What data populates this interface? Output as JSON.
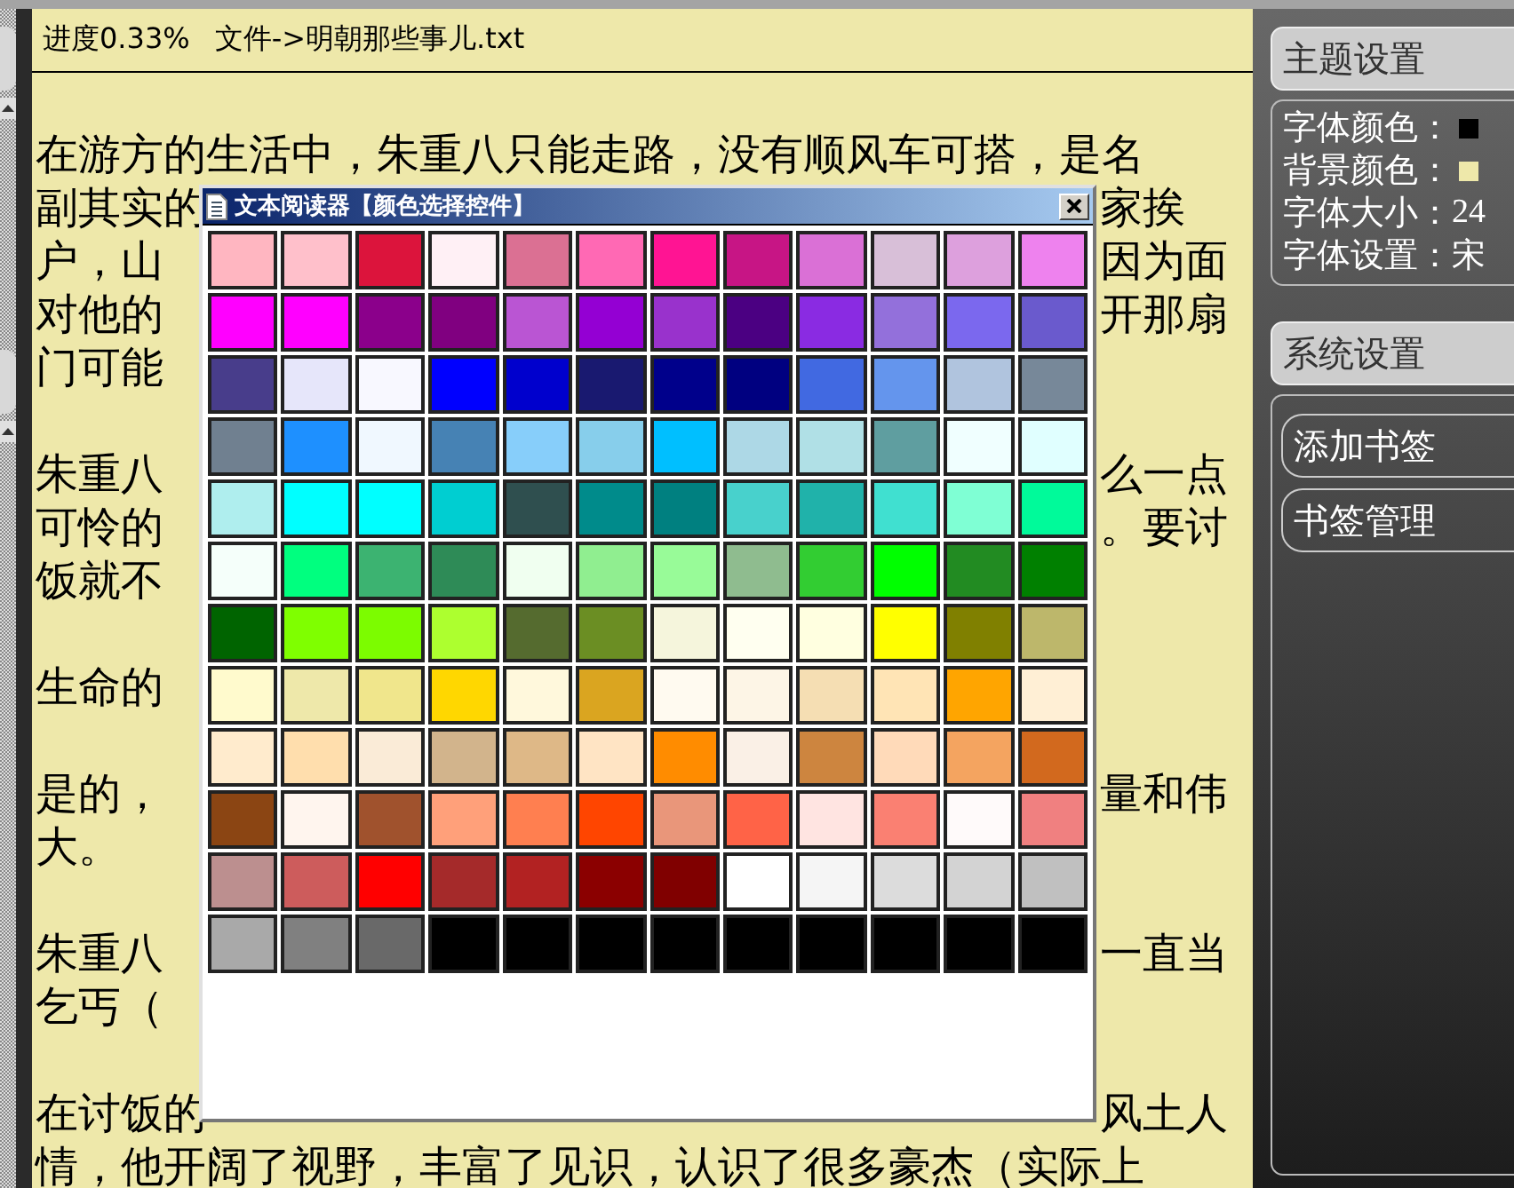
{
  "reader": {
    "progress": "进度0.33%",
    "file": "文件->明朝那些事儿.txt",
    "paragraphs": [
      {
        "lines": [
          {
            "left": "在游方的生活中，朱重八只能走路，没有顺风车可搭，是名"
          },
          {
            "left": "副其实的",
            "right": "家挨"
          },
          {
            "left": "户，山",
            "right": "因为面"
          },
          {
            "left": "对他的",
            "right": "开那扇"
          },
          {
            "left": "门可能"
          }
        ]
      },
      {
        "lines": [
          {
            "left": "朱重八",
            "right": "么一点"
          },
          {
            "left": "可怜的",
            "right": "。要讨"
          },
          {
            "left": "饭就不"
          }
        ]
      },
      {
        "lines": [
          {
            "left": "生命的"
          }
        ]
      },
      {
        "lines": [
          {
            "left": "是的，",
            "right": "量和伟"
          },
          {
            "left": "大。"
          }
        ]
      },
      {
        "lines": [
          {
            "left": "朱重八",
            "right": "一直当"
          },
          {
            "left": "乞丐（"
          }
        ]
      },
      {
        "lines": [
          {
            "left": "在讨饭的",
            "right": "风土人"
          },
          {
            "left": "情，他开阔了视野，丰富了见识，认识了很多豪杰（实际上"
          }
        ]
      }
    ]
  },
  "dialog": {
    "title": "文本阅读器【颜色选择控件】",
    "swatch_rows": [
      [
        {
          "color": "#ffb6c1"
        },
        {
          "color": "#ffc0cb"
        },
        {
          "color": "#dc143c"
        },
        {
          "color": "#fff0f5"
        },
        {
          "color": "#db7093"
        },
        {
          "color": "#ff69b4"
        },
        {
          "color": "#ff1493"
        },
        {
          "color": "#c71585"
        },
        {
          "color": "#da70d6"
        },
        {
          "color": "#d8bfd8"
        },
        {
          "color": "#dda0dd"
        },
        {
          "color": "#ee82ee"
        }
      ],
      [
        {
          "color": "#ff00ff"
        },
        {
          "color": "#ff00ff"
        },
        {
          "color": "#8b008b"
        },
        {
          "color": "#800080"
        },
        {
          "color": "#ba55d3"
        },
        {
          "color": "#9400d3"
        },
        {
          "color": "#9932cc"
        },
        {
          "color": "#4b0082"
        },
        {
          "color": "#8a2be2"
        },
        {
          "color": "#9370db"
        },
        {
          "color": "#7b68ee"
        },
        {
          "color": "#6a5acd"
        }
      ],
      [
        {
          "color": "#483d8b"
        },
        {
          "color": "#e6e6fa"
        },
        {
          "color": "#f8f8ff"
        },
        {
          "color": "#0000ff"
        },
        {
          "color": "#0000cd"
        },
        {
          "color": "#191970"
        },
        {
          "color": "#00008b"
        },
        {
          "color": "#000080"
        },
        {
          "color": "#4169e1"
        },
        {
          "color": "#6495ed"
        },
        {
          "color": "#b0c4de"
        },
        {
          "color": "#778899"
        }
      ],
      [
        {
          "color": "#708090"
        },
        {
          "color": "#1e90ff"
        },
        {
          "color": "#f0f8ff"
        },
        {
          "color": "#4682b4"
        },
        {
          "color": "#87cefa"
        },
        {
          "color": "#87ceeb"
        },
        {
          "color": "#00bfff"
        },
        {
          "color": "#add8e6"
        },
        {
          "color": "#b0e0e6"
        },
        {
          "color": "#5f9ea0"
        },
        {
          "color": "#f0ffff"
        },
        {
          "color": "#e0ffff"
        }
      ],
      [
        {
          "color": "#afeeee"
        },
        {
          "color": "#00ffff"
        },
        {
          "color": "#00ffff"
        },
        {
          "color": "#00ced1"
        },
        {
          "color": "#2f4f4f"
        },
        {
          "color": "#008b8b"
        },
        {
          "color": "#008080"
        },
        {
          "color": "#48d1cc"
        },
        {
          "color": "#20b2aa"
        },
        {
          "color": "#40e0d0"
        },
        {
          "color": "#7fffd4"
        },
        {
          "color": "#00fa9a"
        }
      ],
      [
        {
          "color": "#f5fffa"
        },
        {
          "color": "#00ff7f"
        },
        {
          "color": "#3cb371"
        },
        {
          "color": "#2e8b57"
        },
        {
          "color": "#f0fff0"
        },
        {
          "color": "#90ee90"
        },
        {
          "color": "#98fb98"
        },
        {
          "color": "#8fbc8f"
        },
        {
          "color": "#32cd32"
        },
        {
          "color": "#00ff00"
        },
        {
          "color": "#228b22"
        },
        {
          "color": "#008000"
        }
      ],
      [
        {
          "color": "#006400"
        },
        {
          "color": "#7fff00"
        },
        {
          "color": "#7cfc00"
        },
        {
          "color": "#adff2f"
        },
        {
          "color": "#556b2f"
        },
        {
          "color": "#6b8e23"
        },
        {
          "color": "#f5f5dc"
        },
        {
          "color": "#fffff0"
        },
        {
          "color": "#ffffe0"
        },
        {
          "color": "#ffff00"
        },
        {
          "color": "#808000"
        },
        {
          "color": "#bdb76b"
        }
      ],
      [
        {
          "color": "#fffacd"
        },
        {
          "color": "#eee8aa"
        },
        {
          "color": "#f0e68c"
        },
        {
          "color": "#ffd700"
        },
        {
          "color": "#fff8dc"
        },
        {
          "color": "#daa520"
        },
        {
          "color": "#fffaf0"
        },
        {
          "color": "#fdf5e6"
        },
        {
          "color": "#f5deb3"
        },
        {
          "color": "#ffe4b5"
        },
        {
          "color": "#ffa500"
        },
        {
          "color": "#ffefd5"
        }
      ],
      [
        {
          "color": "#ffebcd"
        },
        {
          "color": "#ffdead"
        },
        {
          "color": "#faebd7"
        },
        {
          "color": "#d2b48c"
        },
        {
          "color": "#deb887"
        },
        {
          "color": "#ffe4c4"
        },
        {
          "color": "#ff8c00"
        },
        {
          "color": "#faf0e6"
        },
        {
          "color": "#cd853f"
        },
        {
          "color": "#ffdab9"
        },
        {
          "color": "#f4a460"
        },
        {
          "color": "#d2691e"
        }
      ],
      [
        {
          "color": "#8b4513"
        },
        {
          "color": "#fff5ee"
        },
        {
          "color": "#a0522d"
        },
        {
          "color": "#ffa07a"
        },
        {
          "color": "#ff7f50"
        },
        {
          "color": "#ff4500"
        },
        {
          "color": "#e9967a"
        },
        {
          "color": "#ff6347"
        },
        {
          "color": "#ffe4e1"
        },
        {
          "color": "#fa8072"
        },
        {
          "color": "#fffafa"
        },
        {
          "color": "#f08080"
        }
      ],
      [
        {
          "color": "#bc8f8f"
        },
        {
          "color": "#cd5c5c"
        },
        {
          "color": "#ff0000"
        },
        {
          "color": "#a52a2a"
        },
        {
          "color": "#b22222"
        },
        {
          "color": "#8b0000"
        },
        {
          "color": "#800000"
        },
        {
          "color": "#ffffff"
        },
        {
          "color": "#f5f5f5"
        },
        {
          "color": "#dcdcdc"
        },
        {
          "color": "#d3d3d3"
        },
        {
          "color": "#c0c0c0"
        }
      ],
      [
        {
          "color": "#a9a9a9"
        },
        {
          "color": "#808080"
        },
        {
          "color": "#696969"
        },
        {
          "color": "#000000"
        },
        {
          "color": "#000000"
        },
        {
          "color": "#000000"
        },
        {
          "color": "#000000"
        },
        {
          "color": "#000000"
        },
        {
          "color": "#000000"
        },
        {
          "color": "#000000"
        },
        {
          "color": "#000000"
        },
        {
          "color": "#000000"
        }
      ]
    ]
  },
  "theme_settings": {
    "title": "主题设置",
    "rows": [
      {
        "label": "字体颜色：",
        "kind": "swatch",
        "color": "#000000"
      },
      {
        "label": "背景颜色：",
        "kind": "swatch",
        "color": "#eee8aa"
      },
      {
        "label": "字体大小：",
        "kind": "text",
        "value": "24"
      },
      {
        "label": "字体设置：",
        "kind": "text",
        "value": "宋"
      }
    ]
  },
  "system_settings": {
    "title": "系统设置",
    "buttons": [
      "添加书签",
      "书签管理"
    ]
  }
}
